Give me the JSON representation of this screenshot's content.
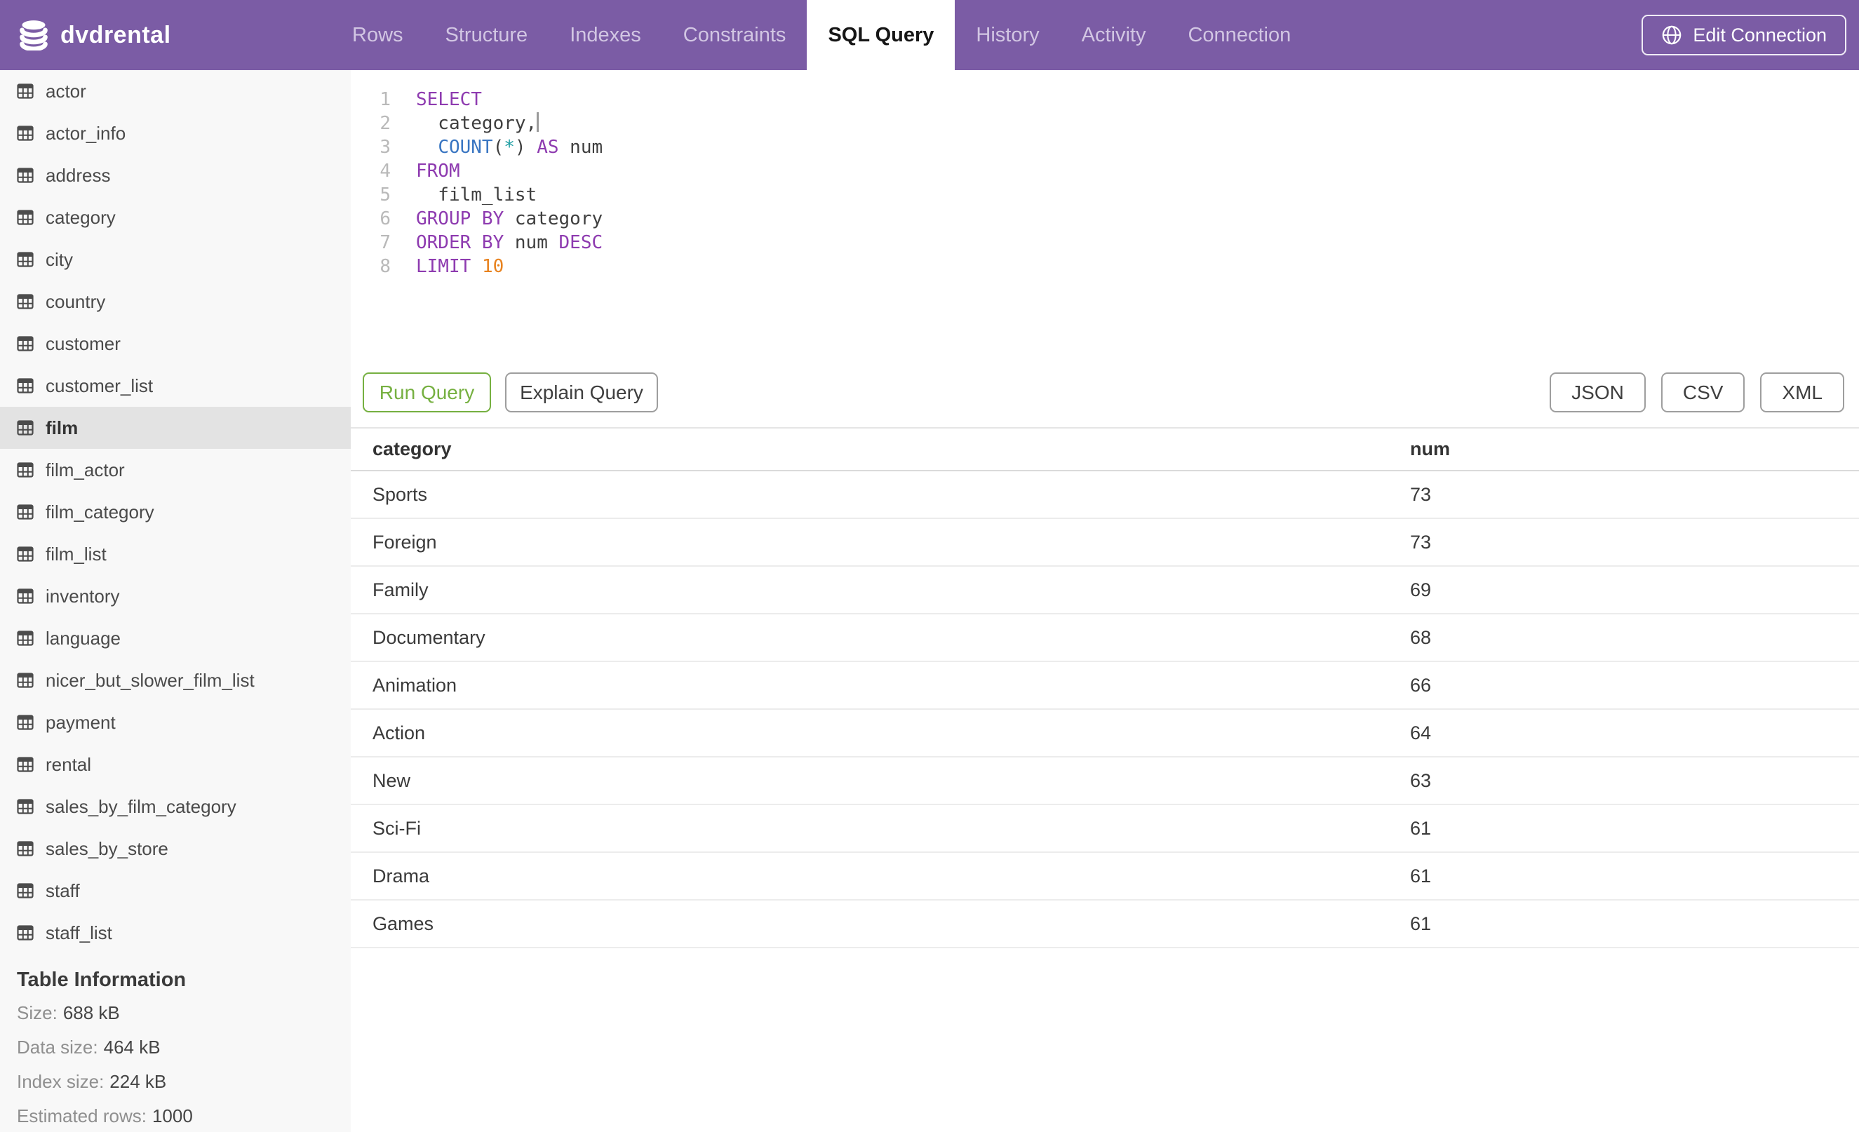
{
  "app": {
    "database": "dvdrental",
    "colors": {
      "brand_purple": "#7b5ca5",
      "accent_green": "#76b041",
      "sidebar_bg": "#f8f8f8",
      "sidebar_selected": "#e3e3e3",
      "syntax_keyword": "#8e3bb0",
      "syntax_function": "#3a76c2",
      "syntax_operator": "#189ba0",
      "syntax_number": "#e8821e",
      "syntax_identifier": "#3f3f3f",
      "line_number_gray": "#b9b9b9"
    }
  },
  "header": {
    "tabs": [
      {
        "label": "Rows",
        "active": false
      },
      {
        "label": "Structure",
        "active": false
      },
      {
        "label": "Indexes",
        "active": false
      },
      {
        "label": "Constraints",
        "active": false
      },
      {
        "label": "SQL Query",
        "active": true
      },
      {
        "label": "History",
        "active": false
      },
      {
        "label": "Activity",
        "active": false
      },
      {
        "label": "Connection",
        "active": false
      }
    ],
    "edit_connection_label": "Edit Connection"
  },
  "sidebar": {
    "tables": [
      "actor",
      "actor_info",
      "address",
      "category",
      "city",
      "country",
      "customer",
      "customer_list",
      "film",
      "film_actor",
      "film_category",
      "film_list",
      "inventory",
      "language",
      "nicer_but_slower_film_list",
      "payment",
      "rental",
      "sales_by_film_category",
      "sales_by_store",
      "staff",
      "staff_list"
    ],
    "selected": "film",
    "info": {
      "heading": "Table Information",
      "rows": [
        {
          "label": "Size:",
          "value": "688 kB"
        },
        {
          "label": "Data size:",
          "value": "464 kB"
        },
        {
          "label": "Index size:",
          "value": "224 kB"
        },
        {
          "label": "Estimated rows:",
          "value": "1000"
        }
      ]
    }
  },
  "editor": {
    "query_text": "SELECT\n  category,\n  COUNT(*) AS num\nFROM\n  film_list\nGROUP BY category\nORDER BY num DESC\nLIMIT 10",
    "lines": [
      {
        "num": "1",
        "tokens": [
          {
            "text": "SELECT",
            "type": "kw"
          }
        ]
      },
      {
        "num": "2",
        "cursor": true,
        "tokens": [
          {
            "text": "  category,",
            "type": "id"
          }
        ]
      },
      {
        "num": "3",
        "tokens": [
          {
            "text": "  ",
            "type": "id"
          },
          {
            "text": "COUNT",
            "type": "fn"
          },
          {
            "text": "(",
            "type": "pu"
          },
          {
            "text": "*",
            "type": "op"
          },
          {
            "text": ")",
            "type": "pu"
          },
          {
            "text": " ",
            "type": "id"
          },
          {
            "text": "AS",
            "type": "kw"
          },
          {
            "text": " num",
            "type": "id"
          }
        ]
      },
      {
        "num": "4",
        "tokens": [
          {
            "text": "FROM",
            "type": "kw"
          }
        ]
      },
      {
        "num": "5",
        "tokens": [
          {
            "text": "  film_list",
            "type": "id"
          }
        ]
      },
      {
        "num": "6",
        "tokens": [
          {
            "text": "GROUP BY",
            "type": "kw"
          },
          {
            "text": " category",
            "type": "id"
          }
        ]
      },
      {
        "num": "7",
        "tokens": [
          {
            "text": "ORDER BY",
            "type": "kw"
          },
          {
            "text": " num ",
            "type": "id"
          },
          {
            "text": "DESC",
            "type": "kw"
          }
        ]
      },
      {
        "num": "8",
        "tokens": [
          {
            "text": "LIMIT",
            "type": "kw"
          },
          {
            "text": " ",
            "type": "id"
          },
          {
            "text": "10",
            "type": "num"
          }
        ]
      }
    ]
  },
  "toolbar": {
    "run_label": "Run Query",
    "explain_label": "Explain Query",
    "export_buttons": [
      "JSON",
      "CSV",
      "XML"
    ]
  },
  "results": {
    "columns": [
      "category",
      "num"
    ],
    "rows": [
      [
        "Sports",
        "73"
      ],
      [
        "Foreign",
        "73"
      ],
      [
        "Family",
        "69"
      ],
      [
        "Documentary",
        "68"
      ],
      [
        "Animation",
        "66"
      ],
      [
        "Action",
        "64"
      ],
      [
        "New",
        "63"
      ],
      [
        "Sci-Fi",
        "61"
      ],
      [
        "Drama",
        "61"
      ],
      [
        "Games",
        "61"
      ]
    ]
  }
}
